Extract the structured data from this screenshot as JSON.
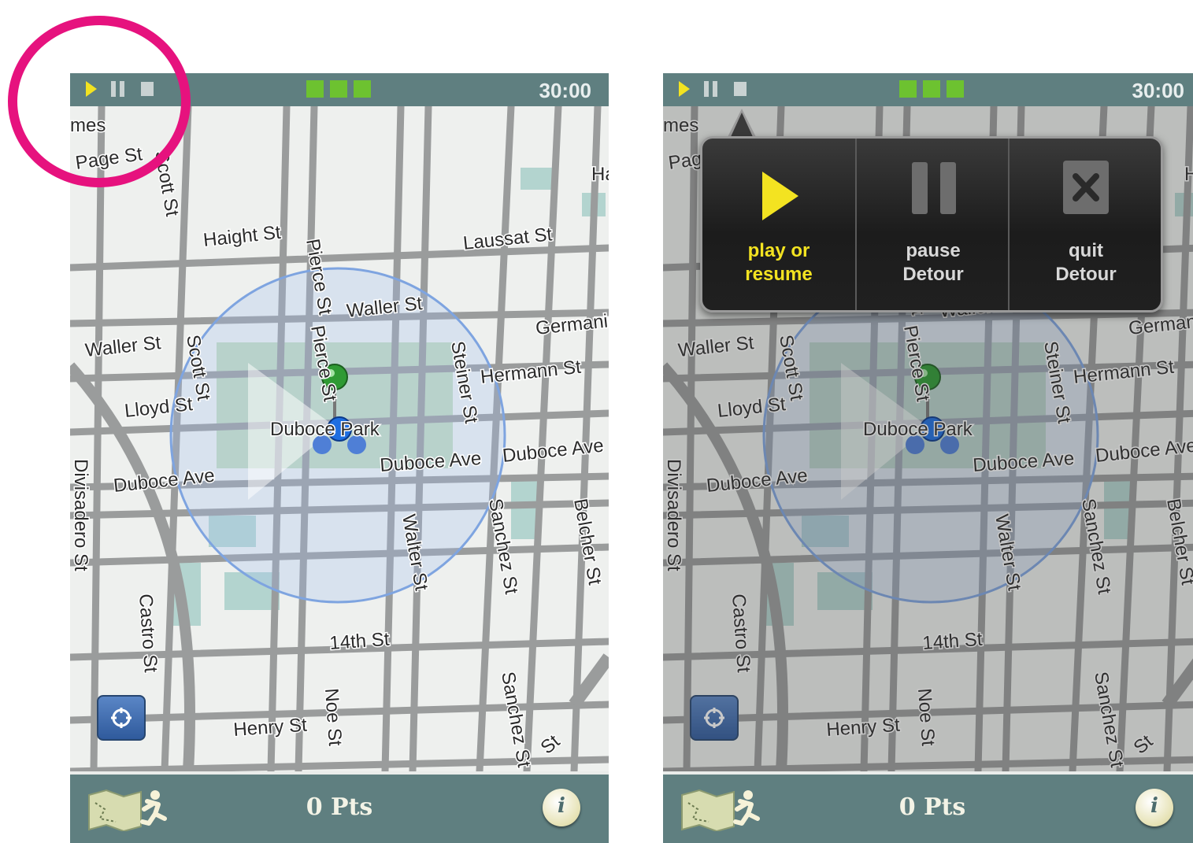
{
  "status_bar": {
    "controls": [
      "play-icon",
      "pause-icon",
      "stop-icon"
    ],
    "progress_segments": 3,
    "timer": "30:00"
  },
  "map": {
    "labels": {
      "mes": "mes",
      "page": "Page St",
      "scott_top": "Scott St",
      "haight": "Haight St",
      "laussat": "Laussat St",
      "pierce_1": "Pierce St",
      "waller_right": "Waller St",
      "waller_left": "Waller St",
      "scott": "Scott St",
      "germania": "Germania",
      "pierce_2": "Pierce St",
      "steiner": "Steiner St",
      "hermann": "Hermann St",
      "lloyd": "Lloyd St",
      "duboce_park": "Duboce Park",
      "duboce_ave_mid": "Duboce Ave",
      "duboce_ave_right": "Duboce Ave",
      "duboce_ave_left": "Duboce Ave",
      "divisadero": "Divisadero St",
      "belcher": "Belcher St",
      "walter": "Walter St",
      "sanchez_1": "Sanchez St",
      "castro": "Castro St",
      "fourteenth": "14th St",
      "noe": "Noe St",
      "sanchez_2": "Sanchez St",
      "henry": "Henry St",
      "ha": "Ha",
      "st": "St"
    }
  },
  "bottom_bar": {
    "points": "0 Pts",
    "info": "i"
  },
  "popover": {
    "play_label": "play or\nresume",
    "pause_label": "pause\nDetour",
    "quit_label": "quit\nDetour"
  },
  "colors": {
    "bar": "#5f7f80",
    "play_accent": "#f3e321",
    "progress": "#6dc230",
    "highlight_ring": "#e6127e"
  }
}
